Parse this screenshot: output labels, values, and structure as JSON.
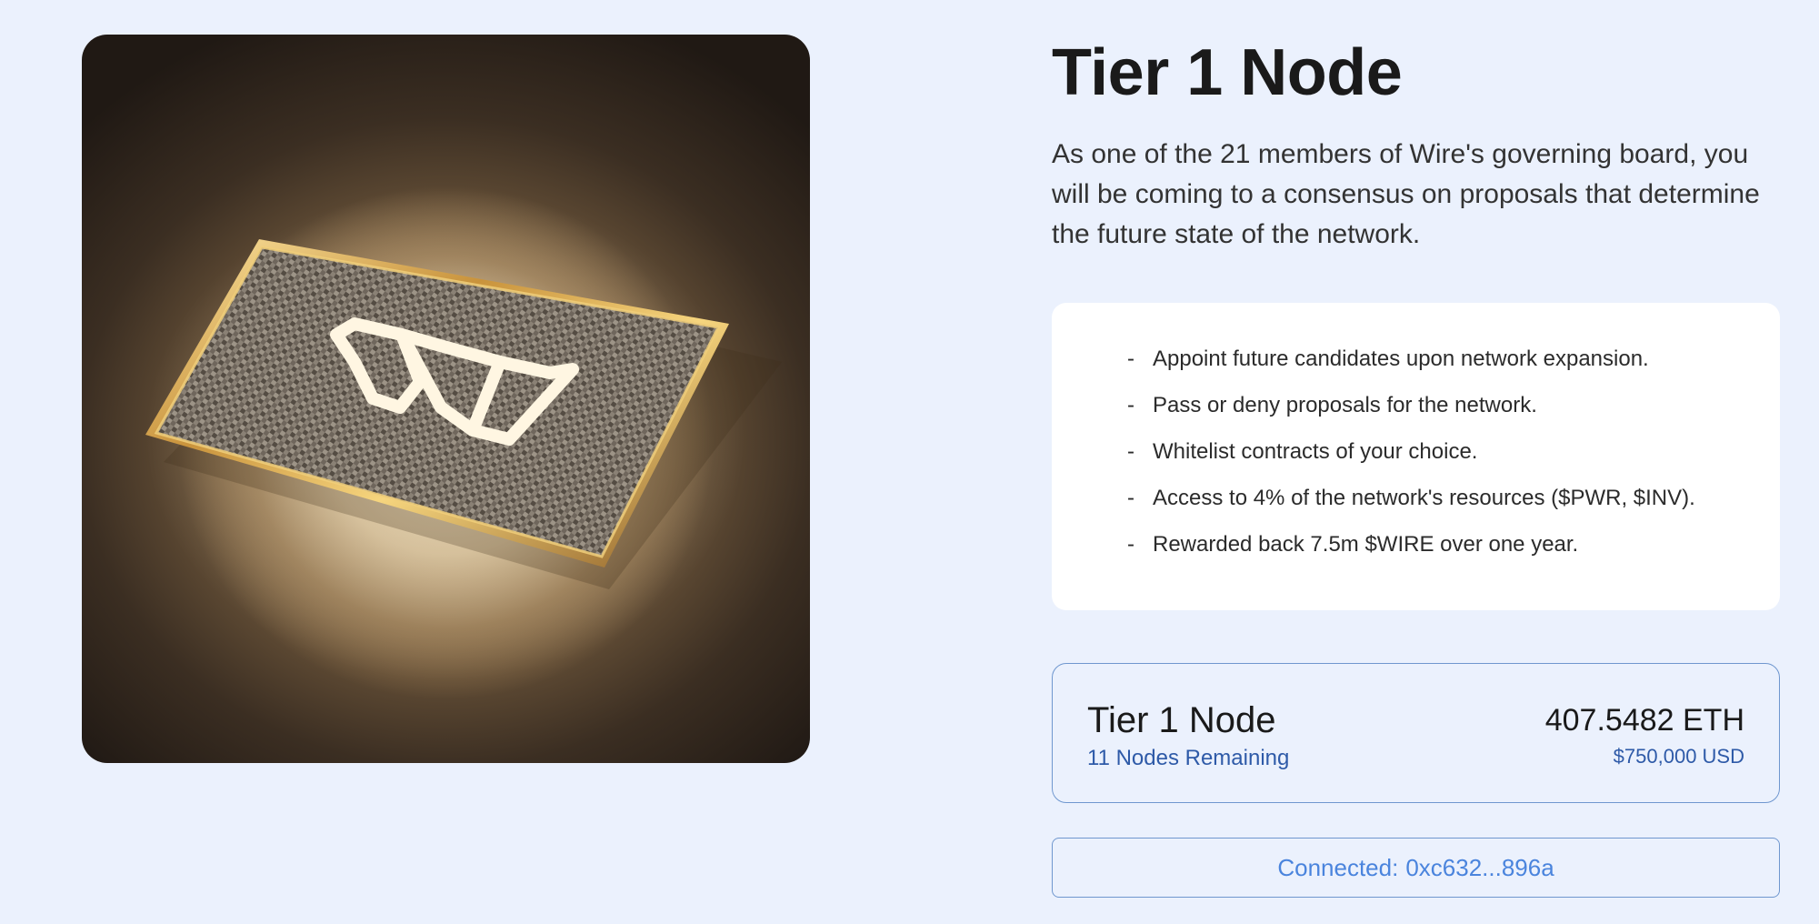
{
  "product": {
    "image_alt_icon": "wire-logo-card-image"
  },
  "header": {
    "title": "Tier 1 Node",
    "description": "As one of the 21 members of Wire's governing board, you will be coming to a consensus on proposals that determine the future state of the network."
  },
  "features": {
    "bullet": "-",
    "items": [
      "Appoint future candidates upon network expansion.",
      "Pass or deny proposals for the network.",
      "Whitelist contracts of your choice.",
      "Access to 4% of the network's resources ($PWR, $INV).",
      "Rewarded back 7.5m $WIRE over one year."
    ]
  },
  "pricing": {
    "node_name": "Tier 1 Node",
    "remaining": "11 Nodes Remaining",
    "price_eth": "407.5482 ETH",
    "price_usd": "$750,000 USD"
  },
  "wallet": {
    "status_label": "Connected:",
    "address": "0xc632...896a"
  },
  "colors": {
    "background": "#ebf1fd",
    "accent_blue": "#4a84dd",
    "border_blue": "#6f97cf",
    "link_blue": "#2e5aa8",
    "card_gold": "#d4a84a"
  }
}
